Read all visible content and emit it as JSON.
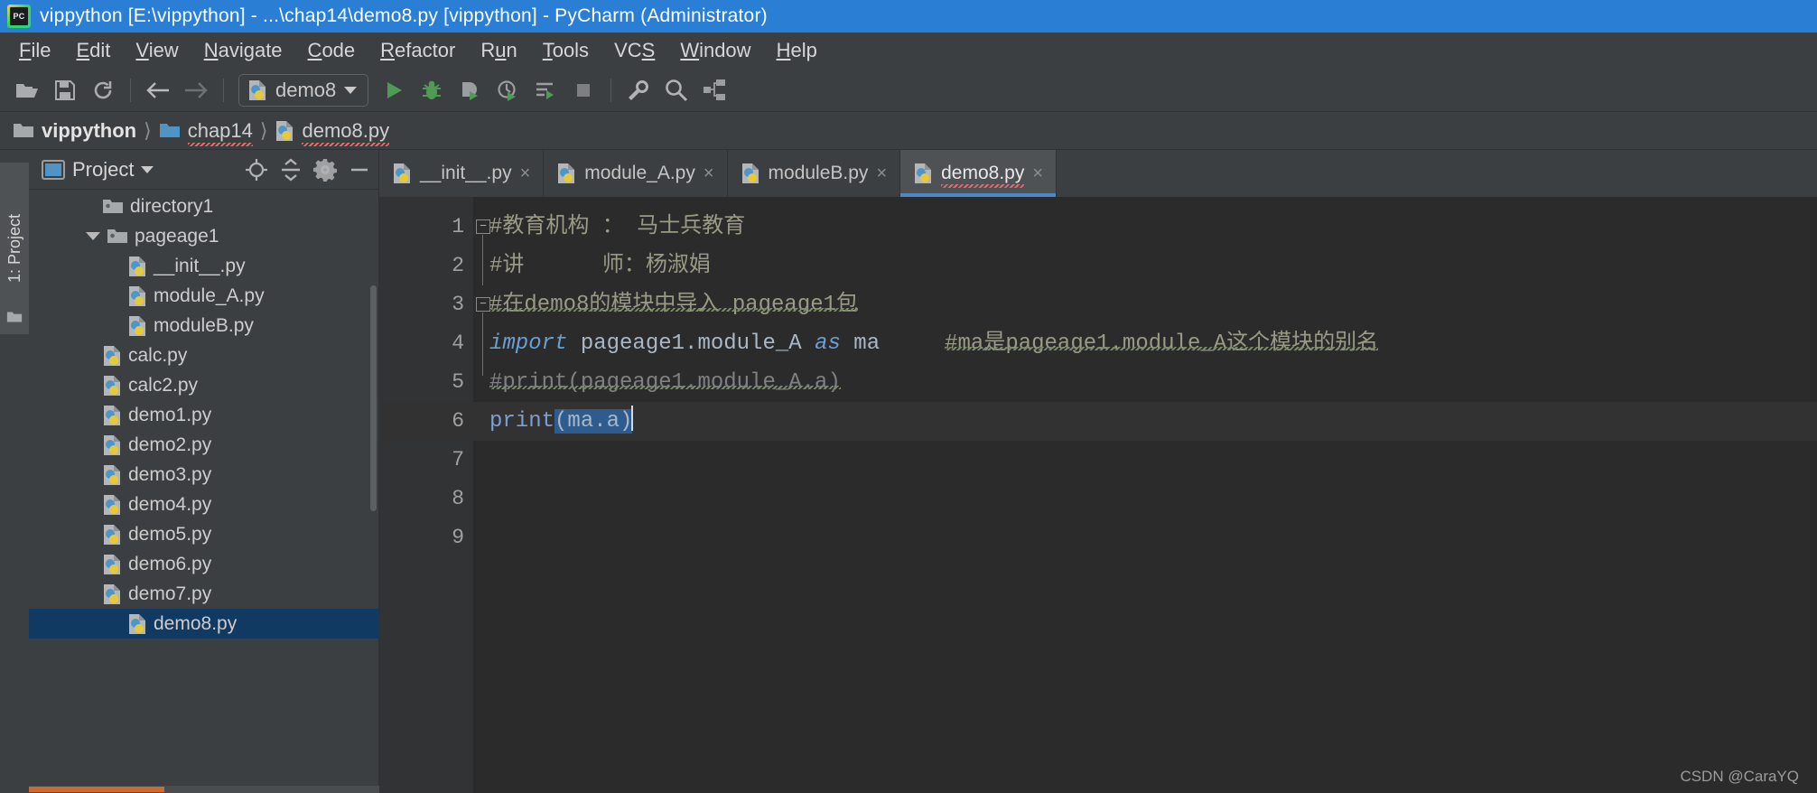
{
  "window": {
    "title": "vippython [E:\\vippython] - ...\\chap14\\demo8.py [vippython] - PyCharm (Administrator)",
    "logo_icon": "pycharm-logo-icon"
  },
  "menubar": {
    "items": [
      {
        "label": "File",
        "mnemonic": "F"
      },
      {
        "label": "Edit",
        "mnemonic": "E"
      },
      {
        "label": "View",
        "mnemonic": "V"
      },
      {
        "label": "Navigate",
        "mnemonic": "N"
      },
      {
        "label": "Code",
        "mnemonic": "C"
      },
      {
        "label": "Refactor",
        "mnemonic": "R"
      },
      {
        "label": "Run",
        "mnemonic": "u"
      },
      {
        "label": "Tools",
        "mnemonic": "T"
      },
      {
        "label": "VCS",
        "mnemonic": "S"
      },
      {
        "label": "Window",
        "mnemonic": "W"
      },
      {
        "label": "Help",
        "mnemonic": "H"
      }
    ]
  },
  "toolbar": {
    "buttons": [
      {
        "name": "open-folder-icon",
        "title": "Open"
      },
      {
        "name": "save-all-icon",
        "title": "Save All"
      },
      {
        "name": "sync-refresh-icon",
        "title": "Synchronize"
      },
      {
        "name": "back-arrow-icon",
        "title": "Back"
      },
      {
        "name": "forward-arrow-icon",
        "title": "Forward"
      }
    ],
    "run_config": {
      "label": "demo8",
      "icon": "python-file-icon",
      "caret": "chevron-down-icon"
    },
    "run_buttons": [
      {
        "name": "run-icon",
        "title": "Run"
      },
      {
        "name": "debug-bug-icon",
        "title": "Debug"
      },
      {
        "name": "run-with-coverage-icon",
        "title": "Run with Coverage"
      },
      {
        "name": "profile-icon",
        "title": "Profile"
      },
      {
        "name": "run-tests-icon",
        "title": "Run Tests"
      },
      {
        "name": "stop-icon",
        "title": "Stop"
      }
    ],
    "right_buttons": [
      {
        "name": "wrench-settings-icon",
        "title": "Settings"
      },
      {
        "name": "search-icon",
        "title": "Search Everywhere"
      },
      {
        "name": "structure-icon",
        "title": "Structure"
      }
    ]
  },
  "breadcrumb": {
    "items": [
      {
        "label": "vippython",
        "icon": "folder-icon",
        "strong": true,
        "squiggle": false
      },
      {
        "label": "chap14",
        "icon": "folder-blue-icon",
        "strong": false,
        "squiggle": true
      },
      {
        "label": "demo8.py",
        "icon": "python-file-icon",
        "strong": false,
        "squiggle": true
      }
    ],
    "separator": "〉"
  },
  "toolwindow_strip": {
    "project_tab": "1: Project",
    "project_tab_mnemonic": "1",
    "folder_icon": "folder-icon"
  },
  "project_panel": {
    "title": "Project",
    "title_icon": "project-window-icon",
    "title_caret": "chevron-down-icon",
    "header_actions": [
      {
        "name": "scroll-from-source-icon",
        "title": "Select Opened File"
      },
      {
        "name": "collapse-all-icon",
        "title": "Collapse All"
      },
      {
        "name": "gear-icon",
        "title": "Settings"
      },
      {
        "name": "minimize-icon",
        "title": "Hide"
      }
    ],
    "tree": [
      {
        "label": "directory1",
        "icon": "folder-package-icon",
        "indent": 2,
        "arrow": "none",
        "selected": false
      },
      {
        "label": "pageage1",
        "icon": "folder-package-icon",
        "indent": 2,
        "arrow": "down",
        "selected": false
      },
      {
        "label": "__init__.py",
        "icon": "python-file-icon",
        "indent": 3,
        "arrow": "none",
        "selected": false
      },
      {
        "label": "module_A.py",
        "icon": "python-file-icon",
        "indent": 3,
        "arrow": "none",
        "selected": false
      },
      {
        "label": "moduleB.py",
        "icon": "python-file-icon",
        "indent": 3,
        "arrow": "none",
        "selected": false
      },
      {
        "label": "calc.py",
        "icon": "python-file-icon",
        "indent": 2,
        "arrow": "none",
        "selected": false
      },
      {
        "label": "calc2.py",
        "icon": "python-file-icon",
        "indent": 2,
        "arrow": "none",
        "selected": false
      },
      {
        "label": "demo1.py",
        "icon": "python-file-icon",
        "indent": 2,
        "arrow": "none",
        "selected": false
      },
      {
        "label": "demo2.py",
        "icon": "python-file-icon",
        "indent": 2,
        "arrow": "none",
        "selected": false
      },
      {
        "label": "demo3.py",
        "icon": "python-file-icon",
        "indent": 2,
        "arrow": "none",
        "selected": false
      },
      {
        "label": "demo4.py",
        "icon": "python-file-icon",
        "indent": 2,
        "arrow": "none",
        "selected": false
      },
      {
        "label": "demo5.py",
        "icon": "python-file-icon",
        "indent": 2,
        "arrow": "none",
        "selected": false
      },
      {
        "label": "demo6.py",
        "icon": "python-file-icon",
        "indent": 2,
        "arrow": "none",
        "selected": false
      },
      {
        "label": "demo7.py",
        "icon": "python-file-icon",
        "indent": 2,
        "arrow": "none",
        "selected": false
      },
      {
        "label": "demo8.py",
        "icon": "python-file-icon",
        "indent": 3,
        "arrow": "none",
        "selected": true
      }
    ]
  },
  "editor": {
    "tabs": [
      {
        "label": "__init__.py",
        "icon": "python-file-icon",
        "active": false,
        "close": "×"
      },
      {
        "label": "module_A.py",
        "icon": "python-file-icon",
        "active": false,
        "close": "×"
      },
      {
        "label": "moduleB.py",
        "icon": "python-file-icon",
        "active": false,
        "close": "×"
      },
      {
        "label": "demo8.py",
        "icon": "python-file-icon",
        "active": true,
        "close": "×"
      }
    ],
    "line_numbers": [
      "1",
      "2",
      "3",
      "4",
      "5",
      "6",
      "7",
      "8",
      "9"
    ],
    "current_line": 6,
    "lines": {
      "l1": "#教育机构 ： 马士兵教育",
      "l2": "#讲      师：杨淑娟",
      "l3": "#在demo8的模块中导入 pageage1包",
      "l4_kw_import": "import",
      "l4_module": " pageage1.module_A ",
      "l4_kw_as": "as",
      "l4_alias": " ma",
      "l4_comment": "#ma是pageage1.module_A这个模块的别名",
      "l5": "#print(pageage1.module_A.a)",
      "l6_fn": "print",
      "l6_args": "(ma.a)"
    }
  },
  "watermark": "CSDN @CaraYQ",
  "colors": {
    "title_bar": "#2a7fd4",
    "chrome": "#3c3f41",
    "editor_bg": "#2b2b2b",
    "gutter_bg": "#313335",
    "selection": "#2f5c8f",
    "tree_selected": "#113a62",
    "tab_underline": "#4a88c7",
    "keyword": "#cc7832",
    "comment": "#808080",
    "run_green": "#4f9b55"
  }
}
